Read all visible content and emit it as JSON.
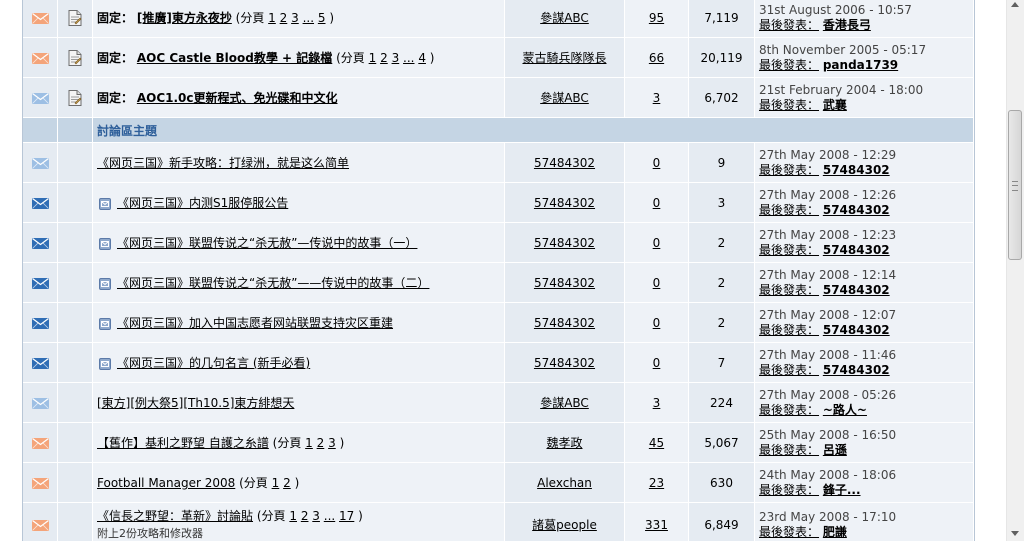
{
  "pinned_prefix": "固定：",
  "last_post_label": "最後發表：",
  "section_title": "討論區主題",
  "pages_prefix": "(分頁",
  "pages_suffix": ")",
  "pinned_topics": [
    {
      "title": "[推廣]東方永夜抄",
      "pages": [
        "1",
        "2",
        "3",
        "...",
        "5"
      ],
      "author": "參謀ABC",
      "replies": "95",
      "views": "7,119",
      "last_date": "31st August 2006 - 10:57",
      "last_user": "香港長弓",
      "icon_color": "#f4a47a"
    },
    {
      "title": "AOC Castle Blood教學 + 記錄檔",
      "pages": [
        "1",
        "2",
        "3",
        "...",
        "4"
      ],
      "author": "蒙古騎兵隊隊長",
      "replies": "66",
      "views": "20,119",
      "last_date": "8th November 2005 - 05:17",
      "last_user": "panda1739",
      "icon_color": "#f4a47a"
    },
    {
      "title": "AOC1.0c更新程式、免光碟和中文化",
      "pages": [],
      "author": "參謀ABC",
      "replies": "3",
      "views": "6,702",
      "last_date": "21st February 2004 - 18:00",
      "last_user": "武襄",
      "icon_color": "#9dbfe4"
    }
  ],
  "topics": [
    {
      "title": "《网页三国》新手攻略：打绿洲，就是这么简单",
      "mini": false,
      "pages": [],
      "author": "57484302",
      "replies": "0",
      "views": "9",
      "last_date": "27th May 2008 - 12:29",
      "last_user": "57484302",
      "icon_color": "#9dbfe4",
      "sub": ""
    },
    {
      "title": "《网页三国》内测S1服停服公告",
      "mini": true,
      "pages": [],
      "author": "57484302",
      "replies": "0",
      "views": "3",
      "last_date": "27th May 2008 - 12:26",
      "last_user": "57484302",
      "icon_color": "#2f6db5",
      "sub": ""
    },
    {
      "title": "《网页三国》联盟传说之“杀无赦”—传说中的故事（一）",
      "mini": true,
      "pages": [],
      "author": "57484302",
      "replies": "0",
      "views": "2",
      "last_date": "27th May 2008 - 12:23",
      "last_user": "57484302",
      "icon_color": "#2f6db5",
      "sub": ""
    },
    {
      "title": "《网页三国》联盟传说之“杀无赦”——传说中的故事（二）",
      "mini": true,
      "pages": [],
      "author": "57484302",
      "replies": "0",
      "views": "2",
      "last_date": "27th May 2008 - 12:14",
      "last_user": "57484302",
      "icon_color": "#2f6db5",
      "sub": ""
    },
    {
      "title": "《网页三国》加入中国志愿者网站联盟支持灾区重建",
      "mini": true,
      "pages": [],
      "author": "57484302",
      "replies": "0",
      "views": "2",
      "last_date": "27th May 2008 - 12:07",
      "last_user": "57484302",
      "icon_color": "#2f6db5",
      "sub": ""
    },
    {
      "title": "《网页三国》的几句名言 (新手必看)",
      "mini": true,
      "pages": [],
      "author": "57484302",
      "replies": "0",
      "views": "7",
      "last_date": "27th May 2008 - 11:46",
      "last_user": "57484302",
      "icon_color": "#2f6db5",
      "sub": ""
    },
    {
      "title": "[東方][例大祭5][Th10.5]東方緋想天",
      "mini": false,
      "pages": [],
      "author": "參謀ABC",
      "replies": "3",
      "views": "224",
      "last_date": "27th May 2008 - 05:26",
      "last_user": "~路人~",
      "icon_color": "#9dbfe4",
      "sub": ""
    },
    {
      "title": "【舊作】基利之野望 自護之糸譜",
      "mini": false,
      "pages": [
        "1",
        "2",
        "3"
      ],
      "author": "魏孝政",
      "replies": "45",
      "views": "5,067",
      "last_date": "25th May 2008 - 16:50",
      "last_user": "呂遜",
      "icon_color": "#f4a47a",
      "sub": ""
    },
    {
      "title": "Football Manager 2008",
      "mini": false,
      "pages": [
        "1",
        "2"
      ],
      "author": "Alexchan",
      "replies": "23",
      "views": "630",
      "last_date": "24th May 2008 - 18:06",
      "last_user": "鋒子...",
      "icon_color": "#f4a47a",
      "sub": ""
    },
    {
      "title": "《信長之野望：革新》討論貼",
      "mini": false,
      "pages": [
        "1",
        "2",
        "3",
        "...",
        "17"
      ],
      "author": "諸葛people",
      "replies": "331",
      "views": "6,849",
      "last_date": "23rd May 2008 - 17:10",
      "last_user": "肥謙",
      "icon_color": "#f4a47a",
      "sub": "附上2份攻略和修改器"
    }
  ]
}
